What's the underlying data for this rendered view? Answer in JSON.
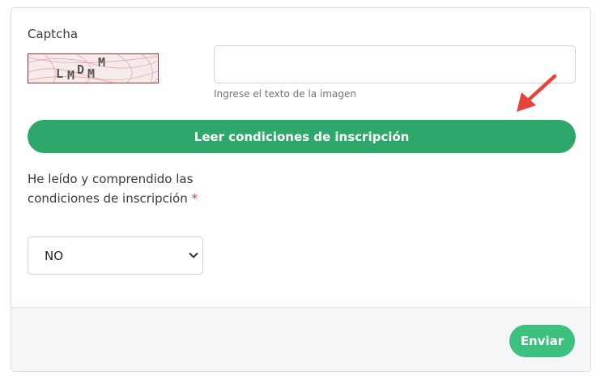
{
  "form": {
    "captcha_label": "Captcha",
    "captcha_image_text": "LMDMM",
    "captcha_input_value": "",
    "captcha_input_placeholder": "",
    "captcha_help": "Ingrese el texto de la imagen",
    "read_conditions_label": "Leer condiciones de inscripción",
    "agree_label": "He leído y comprendido las condiciones de inscripción",
    "required_marker": "*",
    "agree_select": {
      "selected": "NO",
      "options": [
        "NO"
      ]
    }
  },
  "footer": {
    "send_label": "Enviar"
  },
  "colors": {
    "primary_green": "#2ea86a",
    "send_green": "#3cc17f",
    "required_red": "#d63a4a",
    "annotation_arrow": "#e8423a"
  },
  "icons": {
    "select_chevron": "chevron-down-icon",
    "annotation": "arrow-pointer-icon"
  }
}
